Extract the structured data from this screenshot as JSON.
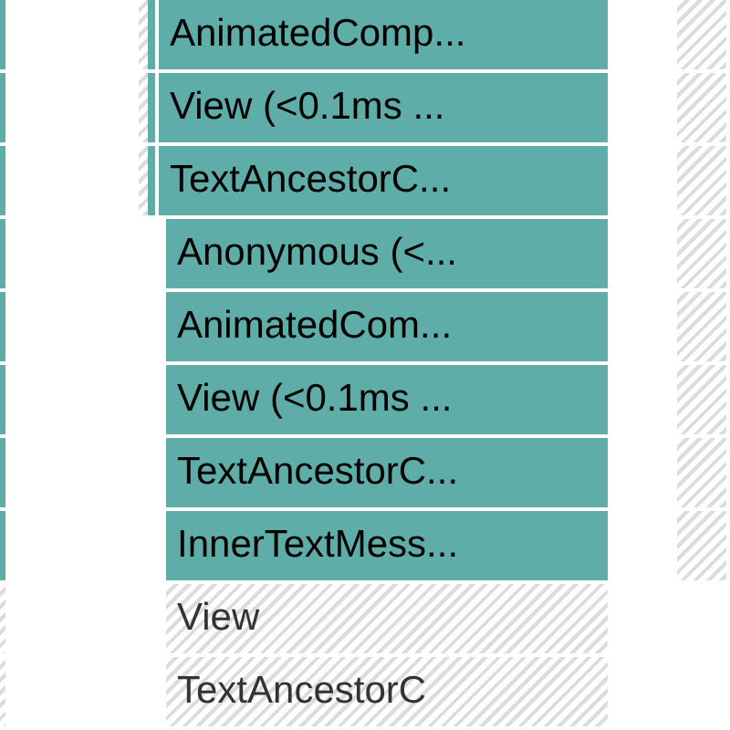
{
  "rows": [
    {
      "label": "AnimatedComp...",
      "rendered": true,
      "side_bars": true,
      "sibling": true
    },
    {
      "label": "View (<0.1ms ...",
      "rendered": true,
      "side_bars": true,
      "sibling": true
    },
    {
      "label": "TextAncestorC...",
      "rendered": true,
      "side_bars": true,
      "sibling": true
    },
    {
      "label": "Anonymous (<...",
      "rendered": true,
      "side_bars": false,
      "sibling": true
    },
    {
      "label": "AnimatedCom...",
      "rendered": true,
      "side_bars": false,
      "sibling": true
    },
    {
      "label": "View (<0.1ms ...",
      "rendered": true,
      "side_bars": false,
      "sibling": true
    },
    {
      "label": "TextAncestorC...",
      "rendered": true,
      "side_bars": false,
      "sibling": true
    },
    {
      "label": "InnerTextMess...",
      "rendered": true,
      "side_bars": false,
      "sibling": true
    },
    {
      "label": "View",
      "rendered": false,
      "side_bars": false,
      "sibling": false
    },
    {
      "label": "TextAncestorC",
      "rendered": false,
      "side_bars": false,
      "sibling": false
    }
  ]
}
